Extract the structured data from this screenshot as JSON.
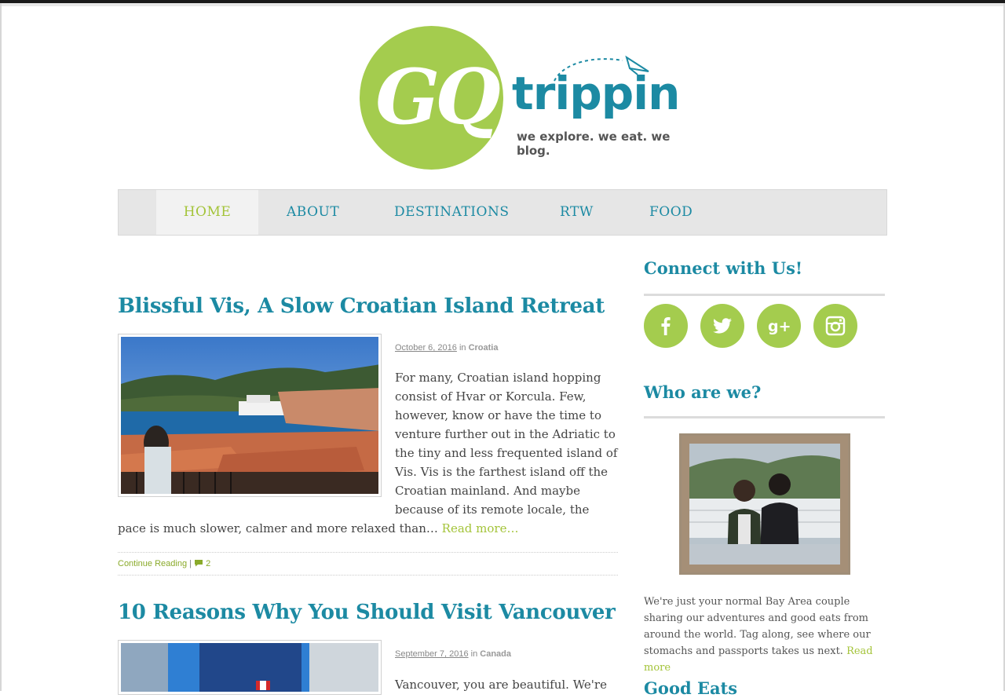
{
  "brand": {
    "logo_mark": "GQ",
    "wordmark": "trippin",
    "tagline": "we explore. we eat. we blog."
  },
  "nav": {
    "items": [
      "HOME",
      "ABOUT",
      "DESTINATIONS",
      "RTW",
      "FOOD"
    ],
    "active": "HOME"
  },
  "posts": [
    {
      "title": "Blissful Vis, A Slow Croatian Island Retreat",
      "date": "October 6, 2016",
      "in_label": "in",
      "category": "Croatia",
      "excerpt": "For many, Croatian island hopping consist of Hvar or Korcula. Few, however, know or have the time to venture further out in the Adriatic to the tiny and less frequented island of Vis. Vis is the farthest island off the Croatian mainland. And maybe because of its remote locale, the pace is much slower, calmer and more relaxed than…",
      "read_more": "Read more…",
      "continue_label": "Continue Reading",
      "separator": "|",
      "comments": "2"
    },
    {
      "title": "10 Reasons Why You Should Visit Vancouver",
      "date": "September 7, 2016",
      "in_label": "in",
      "category": "Canada",
      "excerpt": "Vancouver, you are beautiful. We're"
    }
  ],
  "sidebar": {
    "connect_title": "Connect with Us!",
    "social": [
      "facebook-icon",
      "twitter-icon",
      "google-plus-icon",
      "instagram-icon"
    ],
    "who_title": "Who are we?",
    "about_text": "We're just your normal Bay Area couple sharing our adventures and good eats from around the world. Tag along, see where our stomachs and passports takes us next.",
    "about_link": "Read more",
    "next_title": "Good Eats"
  },
  "colors": {
    "teal": "#1c8aa3",
    "green": "#a4cc4e",
    "nav_bg": "#e6e6e6"
  }
}
